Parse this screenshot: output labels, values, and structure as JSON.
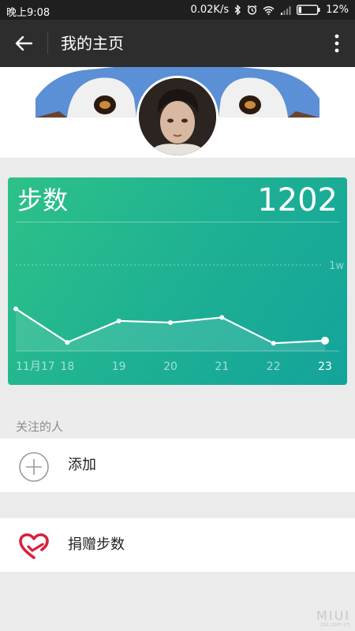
{
  "status_bar": {
    "time": "晚上9:08",
    "network_speed": "0.02K/s",
    "battery": "12%",
    "icons": [
      "bluetooth-icon",
      "alarm-icon",
      "wifi-icon",
      "signal-icon",
      "battery-icon"
    ]
  },
  "app_bar": {
    "title": "我的主页",
    "back_icon": "arrow-left-icon",
    "more_icon": "more-vertical-icon"
  },
  "steps_card": {
    "label": "步数",
    "value": "1202",
    "colors": {
      "start": "#2ec188",
      "end": "#14a39b"
    }
  },
  "chart_data": {
    "type": "area",
    "x": [
      "11月17",
      "18",
      "19",
      "20",
      "21",
      "22",
      "23"
    ],
    "y": [
      4900,
      1000,
      3500,
      3300,
      3900,
      900,
      1202
    ],
    "reference_line": {
      "label": "1w",
      "value": 10000
    },
    "ylim": [
      0,
      11000
    ],
    "grid": false,
    "highlight_last": true
  },
  "following": {
    "header": "关注的人",
    "add_label": "添加"
  },
  "donate": {
    "label": "捐赠步数",
    "accent": "#d8203c"
  },
  "watermark": {
    "brand": "MIUI",
    "sub": "zol.com.cn"
  }
}
